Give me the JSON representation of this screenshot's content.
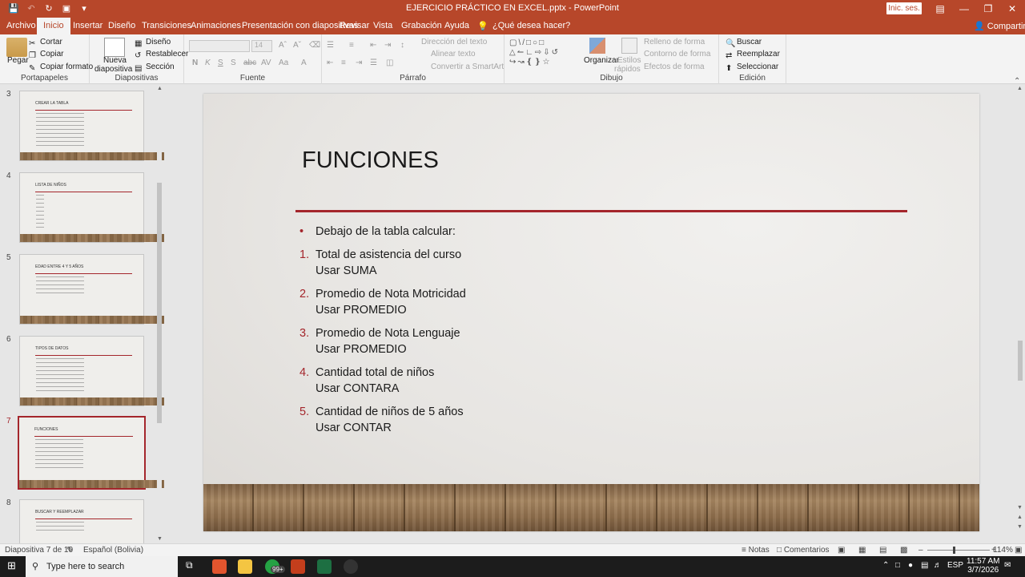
{
  "window": {
    "title": "EJERCICIO PRÁCTICO EN EXCEL.pptx  -  PowerPoint",
    "signin": "Inic. ses.",
    "share": "Compartir",
    "tell_me": "¿Qué desea hacer?"
  },
  "tabs": [
    "Archivo",
    "Inicio",
    "Insertar",
    "Diseño",
    "Transiciones",
    "Animaciones",
    "Presentación con diapositivas",
    "Revisar",
    "Vista",
    "Grabación",
    "Ayuda"
  ],
  "ribbon": {
    "clipboard": {
      "label": "Portapapeles",
      "paste": "Pegar",
      "cut": "Cortar",
      "copy": "Copiar",
      "format_painter": "Copiar formato"
    },
    "slides": {
      "label": "Diapositivas",
      "new_slide_1": "Nueva",
      "new_slide_2": "diapositiva",
      "layout": "Diseño",
      "reset": "Restablecer",
      "section": "Sección"
    },
    "font": {
      "label": "Fuente",
      "bold": "N",
      "italic": "K",
      "underline": "S",
      "strike": "S",
      "font_size": "14"
    },
    "paragraph": {
      "label": "Párrafo",
      "text_direction": "Dirección del texto",
      "align_text": "Alinear texto",
      "smartart": "Convertir a SmartArt"
    },
    "drawing": {
      "label": "Dibujo",
      "arrange": "Organizar",
      "quick_styles_1": "Estilos",
      "quick_styles_2": "rápidos",
      "shape_fill": "Relleno de forma",
      "shape_outline": "Contorno de forma",
      "shape_effects": "Efectos de forma"
    },
    "editing": {
      "label": "Edición",
      "find": "Buscar",
      "replace": "Reemplazar",
      "select": "Seleccionar"
    }
  },
  "thumbnails": [
    {
      "num": "3",
      "title": "CREAR LA TABLA",
      "selected": false
    },
    {
      "num": "4",
      "title": "LISTA DE NIÑOS",
      "selected": false
    },
    {
      "num": "5",
      "title": "EDAD ENTRE 4 Y 5 AÑOS",
      "selected": false
    },
    {
      "num": "6",
      "title": "TIPOS DE DATOS",
      "selected": false
    },
    {
      "num": "7",
      "title": "FUNCIONES",
      "selected": true
    },
    {
      "num": "8",
      "title": "BUSCAR Y REEMPLAZAR",
      "selected": false
    }
  ],
  "slide": {
    "title": "FUNCIONES",
    "items": [
      {
        "marker": "•",
        "line1": "Debajo de la tabla calcular:",
        "line2": ""
      },
      {
        "marker": "1.",
        "line1": "Total de asistencia del curso",
        "line2": "Usar SUMA"
      },
      {
        "marker": "2.",
        "line1": "Promedio de Nota Motricidad",
        "line2": "Usar PROMEDIO"
      },
      {
        "marker": "3.",
        "line1": "Promedio de Nota Lenguaje",
        "line2": "Usar PROMEDIO"
      },
      {
        "marker": "4.",
        "line1": "Cantidad total de niños",
        "line2": "Usar CONTARA"
      },
      {
        "marker": "5.",
        "line1": "Cantidad de niños de 5 años",
        "line2": "Usar CONTAR"
      }
    ]
  },
  "status": {
    "slide_count": "Diapositiva 7 de 10",
    "language": "Español (Bolivia)",
    "notes": "Notas",
    "comments": "Comentarios",
    "zoom": "114%",
    "zoom_fraction": 0.42
  },
  "taskbar": {
    "search_placeholder": "Type here to search",
    "lang": "ESP",
    "time": "11:57 AM",
    "date": "3/7/2026",
    "badge": "99+"
  },
  "colors": {
    "accent": "#b7472a",
    "slide_accent": "#a4262c"
  }
}
